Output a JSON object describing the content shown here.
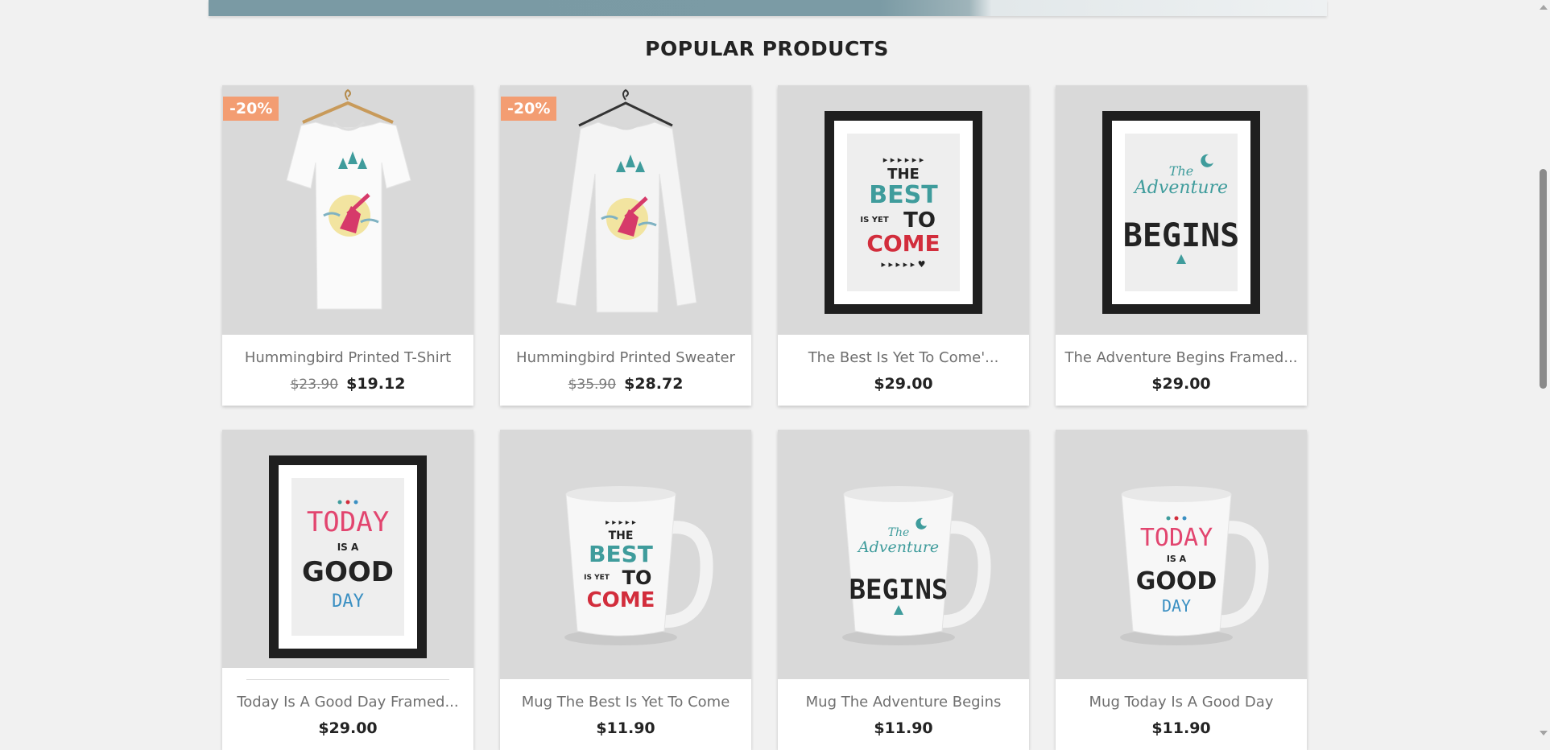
{
  "section": {
    "title": "POPULAR PRODUCTS"
  },
  "products": [
    {
      "name": "Hummingbird Printed T-Shirt",
      "old_price": "$23.90",
      "price": "$19.12",
      "badge": "-20%"
    },
    {
      "name": "Hummingbird Printed Sweater",
      "old_price": "$35.90",
      "price": "$28.72",
      "badge": "-20%"
    },
    {
      "name": "The Best Is Yet To Come'...",
      "price": "$29.00"
    },
    {
      "name": "The Adventure Begins Framed...",
      "price": "$29.00"
    },
    {
      "name": "Today Is A Good Day Framed...",
      "price": "$29.00"
    },
    {
      "name": "Mug The Best Is Yet To Come",
      "price": "$11.90"
    },
    {
      "name": "Mug The Adventure Begins",
      "price": "$11.90"
    },
    {
      "name": "Mug Today Is A Good Day",
      "price": "$11.90"
    }
  ],
  "artwork": {
    "best": {
      "l1": "THE",
      "l2": "BEST",
      "l3": "IS YET",
      "l4": "TO",
      "l5": "COME"
    },
    "adventure": {
      "l1": "The",
      "l2": "Adventure",
      "l3": "BEGINS"
    },
    "today": {
      "l1": "TODAY",
      "l2": "IS A",
      "l3": "GOOD",
      "l4": "DAY"
    }
  },
  "colors": {
    "badge": "#f39d72",
    "teal": "#3f9c9c",
    "red": "#d22d3c",
    "pink": "#e2456f",
    "blue": "#3a8fc2",
    "dark": "#232323"
  }
}
